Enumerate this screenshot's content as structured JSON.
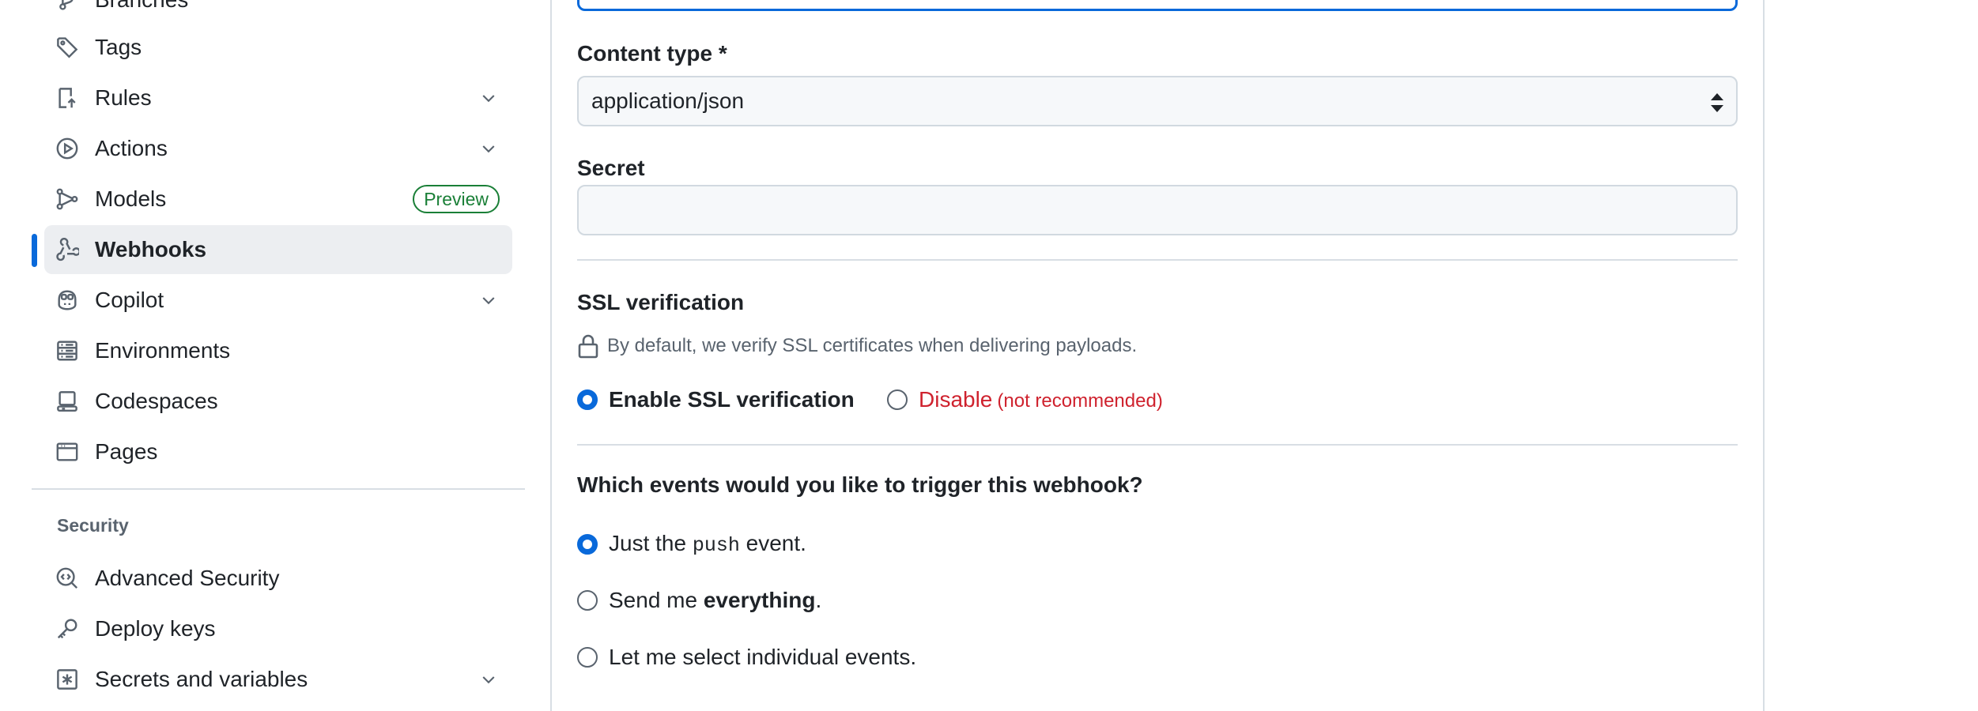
{
  "sidebar": {
    "items": [
      {
        "label": "Branches",
        "icon": "branch-icon"
      },
      {
        "label": "Tags",
        "icon": "tag-icon"
      },
      {
        "label": "Rules",
        "icon": "rules-icon",
        "expandable": true
      },
      {
        "label": "Actions",
        "icon": "play-icon",
        "expandable": true
      },
      {
        "label": "Models",
        "icon": "models-icon",
        "badge": "Preview"
      },
      {
        "label": "Webhooks",
        "icon": "webhook-icon",
        "active": true
      },
      {
        "label": "Copilot",
        "icon": "copilot-icon",
        "expandable": true
      },
      {
        "label": "Environments",
        "icon": "server-icon"
      },
      {
        "label": "Codespaces",
        "icon": "codespaces-icon"
      },
      {
        "label": "Pages",
        "icon": "browser-icon"
      }
    ],
    "security_heading": "Security",
    "security_items": [
      {
        "label": "Advanced Security",
        "icon": "codescan-icon"
      },
      {
        "label": "Deploy keys",
        "icon": "key-icon"
      },
      {
        "label": "Secrets and variables",
        "icon": "asterisk-icon",
        "expandable": true
      }
    ]
  },
  "form": {
    "content_type_label": "Content type *",
    "content_type_value": "application/json",
    "secret_label": "Secret",
    "secret_value": "",
    "ssl_heading": "SSL verification",
    "ssl_note": "By default, we verify SSL certificates when delivering payloads.",
    "ssl_enable_label": "Enable SSL verification",
    "ssl_disable_label": "Disable",
    "ssl_disable_note": "(not recommended)",
    "events_heading": "Which events would you like to trigger this webhook?",
    "event_push_prefix": "Just the",
    "event_push_code": "push",
    "event_push_suffix": "event.",
    "event_all_prefix": "Send me",
    "event_all_bold": "everything",
    "event_all_suffix": ".",
    "event_select_label": "Let me select individual events.",
    "selected_event": "push",
    "ssl_selected": "enable"
  },
  "colors": {
    "accent": "#0969da",
    "danger": "#cf222e",
    "success": "#1a7f37"
  }
}
